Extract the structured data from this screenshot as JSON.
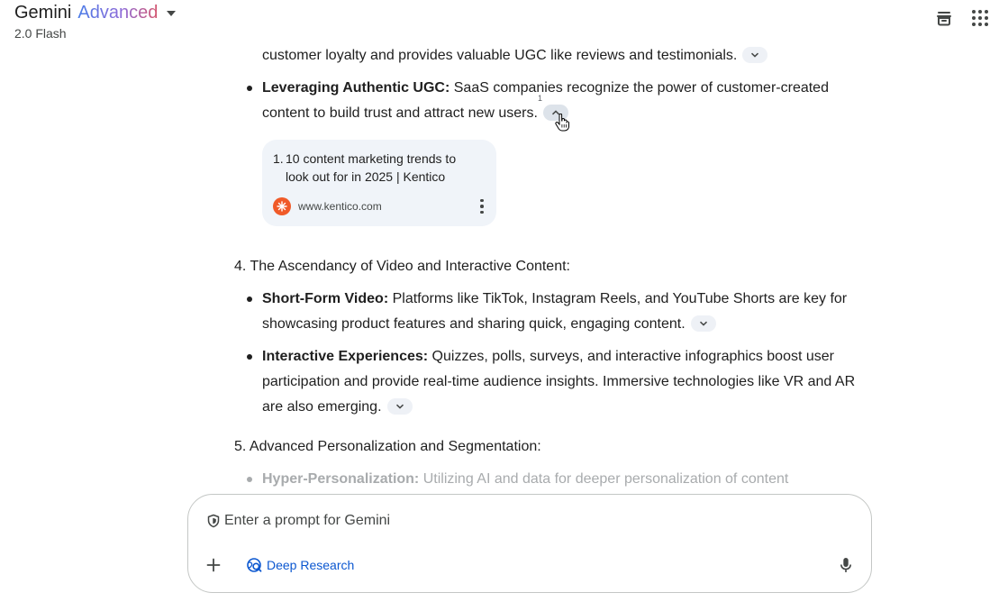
{
  "header": {
    "brand_name": "Gemini",
    "brand_tier": "Advanced",
    "model": "2.0 Flash",
    "icons": [
      "incognito-icon",
      "apps-grid-icon"
    ]
  },
  "response": {
    "prev_bullet_tail": "customer loyalty and provides valuable UGC like reviews and testimonials.",
    "ugc_bullet": {
      "title": "Leveraging Authentic UGC:",
      "line1": " SaaS companies recognize the power of customer-created",
      "line2": "content to build trust and attract new users.",
      "citation_number": "1"
    },
    "source": {
      "number": "1.",
      "title": "10 content marketing trends to look out for in 2025 | Kentico",
      "domain": "www.kentico.com"
    },
    "section4": {
      "heading": "4. The Ascendancy of Video and Interactive Content:",
      "bullets": [
        {
          "title": "Short-Form Video:",
          "line1": " Platforms like TikTok, Instagram Reels, and YouTube Shorts are key for",
          "line2": "showcasing product features and sharing quick, engaging content."
        },
        {
          "title": "Interactive Experiences:",
          "line1": " Quizzes, polls, surveys, and interactive infographics boost user",
          "line2": "participation and provide real-time audience insights. Immersive technologies like VR and AR",
          "line3": "are also emerging."
        }
      ]
    },
    "section5": {
      "heading": "5. Advanced Personalization and Segmentation:",
      "bullet": {
        "title": "Hyper-Personalization:",
        "text": " Utilizing AI and data for deeper personalization of content"
      }
    }
  },
  "input": {
    "placeholder": "Enter a prompt for Gemini",
    "value": "",
    "deep_research_label": "Deep Research"
  },
  "colors": {
    "accent_blue": "#0b57d0",
    "chip_bg": "#eef1f6",
    "card_bg": "#f0f4f9",
    "kentico_orange": "#f05a28"
  }
}
